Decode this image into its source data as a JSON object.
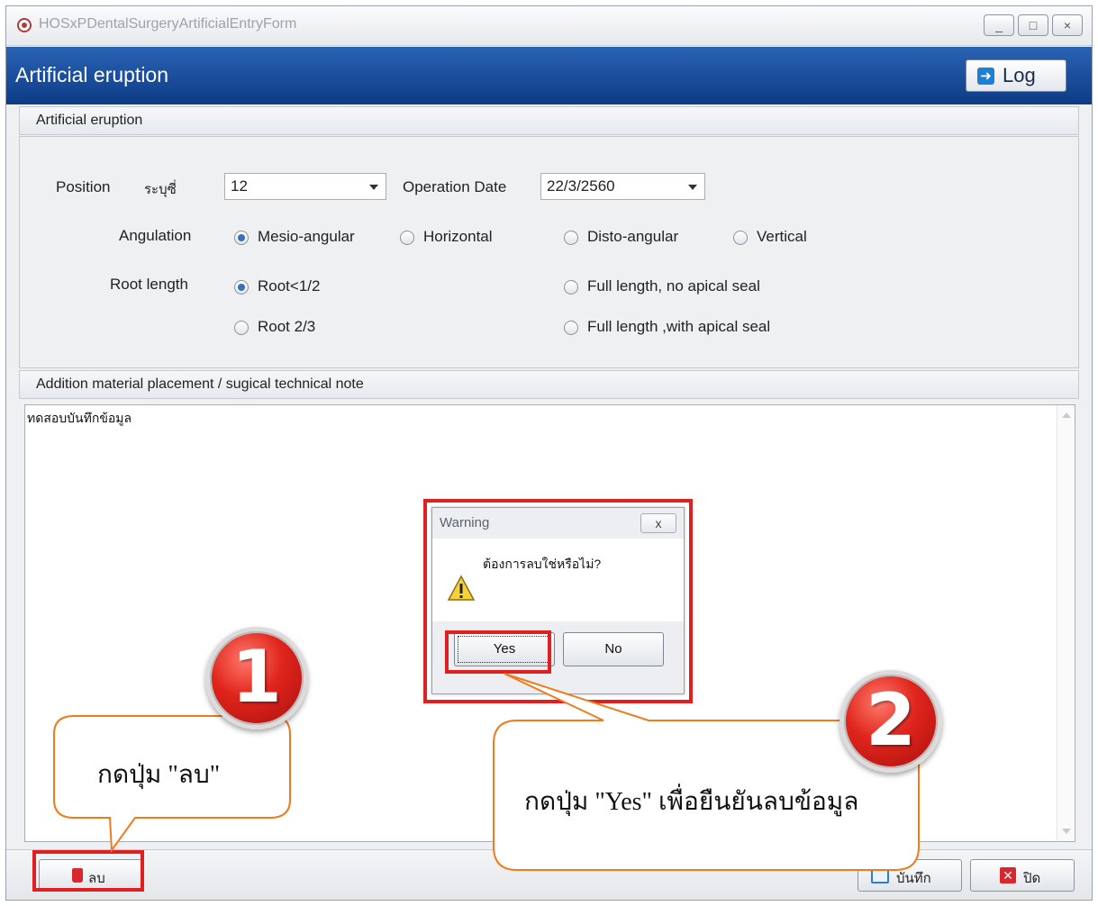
{
  "window": {
    "title": "HOSxPDentalSurgeryArtificialEntryForm",
    "min_glyph": "_",
    "max_glyph": "□",
    "close_glyph": "×"
  },
  "header": {
    "title": "Artificial eruption",
    "log_label": "Log",
    "log_icon": "exit-arrow-icon",
    "colors": {
      "header_top": "#2a63b4",
      "header_bottom": "#0d3b85"
    }
  },
  "section1": {
    "title": "Artificial eruption",
    "position_label": "Position",
    "specify_tooth_label": "ระบุซี่",
    "position_value": "12",
    "operation_date_label": "Operation Date",
    "operation_date_value": "22/3/2560",
    "angulation_label": "Angulation",
    "angulation_options": [
      "Mesio-angular",
      "Horizontal",
      "Disto-angular",
      "Vertical"
    ],
    "angulation_selected": "Mesio-angular",
    "root_length_label": "Root length",
    "root_options": [
      "Root<1/2",
      "Full length, no apical seal",
      "Root 2/3",
      "Full length ,with apical seal"
    ],
    "root_selected": "Root<1/2"
  },
  "section2": {
    "title": "Addition material placement / sugical technical note",
    "note_text": "ทดสอบบันทึกข้อมูล"
  },
  "footer": {
    "delete_label": "ลบ",
    "save_label": "บันทึก",
    "close_label": "ปิด"
  },
  "dialog": {
    "title": "Warning",
    "close_glyph": "x",
    "message": "ต้องการลบใช่หรือไม่?",
    "yes_label": "Yes",
    "no_label": "No",
    "icon": "warning-icon"
  },
  "annotations": {
    "badge1": "1",
    "badge2": "2",
    "callout1": "กดปุ่ม \"ลบ\"",
    "callout2": "กดปุ่ม \"Yes\" เพื่อยืนยันลบข้อมูล",
    "highlight_color": "#e02020",
    "callout_border_color": "#f07a1c"
  }
}
